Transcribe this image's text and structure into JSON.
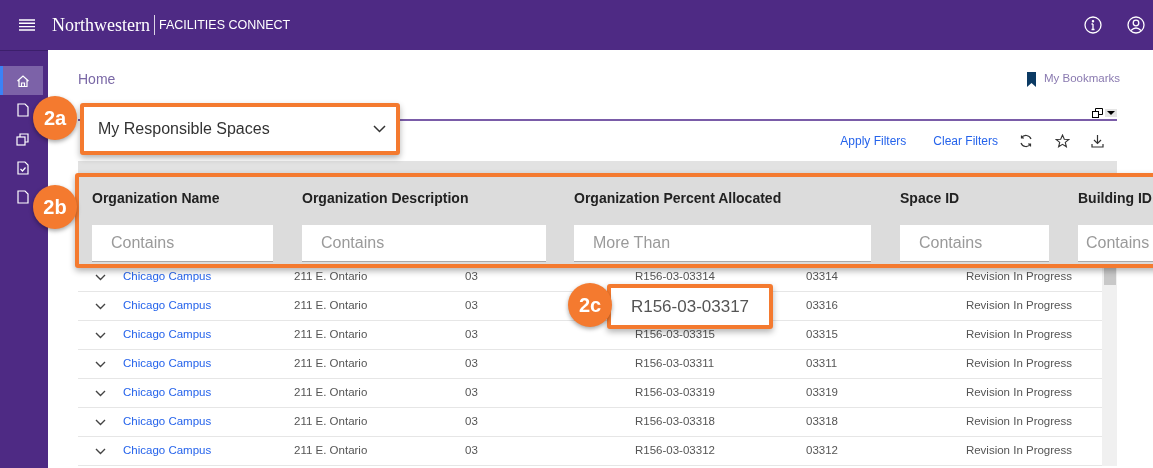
{
  "top_bar": {
    "logo_name": "Northwestern",
    "app_name": "FACILITIES CONNECT"
  },
  "sidebar": {
    "items": [
      {
        "kind": "home",
        "selected": true
      },
      {
        "kind": "document",
        "selected": false
      },
      {
        "kind": "copy",
        "selected": false
      },
      {
        "kind": "checklist",
        "selected": false
      },
      {
        "kind": "document",
        "selected": false
      }
    ]
  },
  "breadcrumb": "Home",
  "bookmarks": "My Bookmarks",
  "view_dropdown": {
    "value": "My Responsible Spaces",
    "callout_label": "2a"
  },
  "toolbar": {
    "links": [
      "Apply Filters",
      "Clear Filters"
    ]
  },
  "filter_header": {
    "callout_label": "2b",
    "columns": [
      {
        "label": "Organization Name",
        "placeholder": "Contains"
      },
      {
        "label": "Organization Description",
        "placeholder": "Contains"
      },
      {
        "label": "Organization Percent Allocated",
        "placeholder": "More Than"
      },
      {
        "label": "Space ID",
        "placeholder": "Contains"
      },
      {
        "label": "Building ID",
        "placeholder": "Contains"
      }
    ]
  },
  "table": {
    "rows": [
      {
        "column_1": "Chicago Campus",
        "column_2": "211 E. Ontario",
        "column_3": "03",
        "column_4": "R156-03-03314",
        "column_5": "03314",
        "column_6": "Revision In Progress"
      },
      {
        "column_1": "Chicago Campus",
        "column_2": "211 E. Ontario",
        "column_3": "03",
        "column_5": "03316",
        "column_6": "Revision In Progress"
      },
      {
        "column_1": "Chicago Campus",
        "column_2": "211 E. Ontario",
        "column_3": "03",
        "column_4": "R156-03-03315",
        "column_5": "03315",
        "column_6": "Revision In Progress"
      },
      {
        "column_1": "Chicago Campus",
        "column_2": "211 E. Ontario",
        "column_3": "03",
        "column_4": "R156-03-03311",
        "column_5": "03311",
        "column_6": "Revision In Progress"
      },
      {
        "column_1": "Chicago Campus",
        "column_2": "211 E. Ontario",
        "column_3": "03",
        "column_4": "R156-03-03319",
        "column_5": "03319",
        "column_6": "Revision In Progress"
      },
      {
        "column_1": "Chicago Campus",
        "column_2": "211 E. Ontario",
        "column_3": "03",
        "column_4": "R156-03-03318",
        "column_5": "03318",
        "column_6": "Revision In Progress"
      },
      {
        "column_1": "Chicago Campus",
        "column_2": "211 E. Ontario",
        "column_3": "03",
        "column_4": "R156-03-03312",
        "column_5": "03312",
        "column_6": "Revision In Progress"
      }
    ]
  },
  "zoom_callout": {
    "label": "2c",
    "text": "R156-03-03317"
  }
}
